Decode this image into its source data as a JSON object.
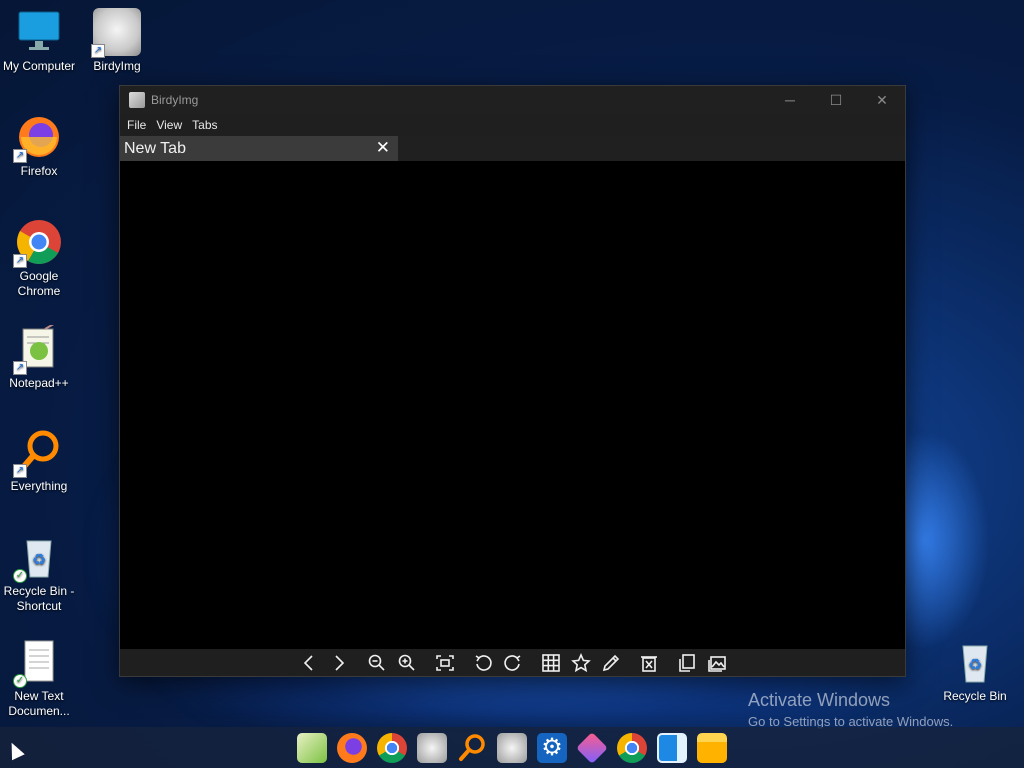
{
  "desktop": {
    "icons": [
      {
        "label": "My Computer"
      },
      {
        "label": "BirdyImg"
      },
      {
        "label": "Firefox"
      },
      {
        "label": "Google Chrome"
      },
      {
        "label": "Notepad++"
      },
      {
        "label": "Everything"
      },
      {
        "label": "Recycle Bin - Shortcut"
      },
      {
        "label": "New Text Documen..."
      },
      {
        "label": "Recycle Bin"
      }
    ]
  },
  "window": {
    "title": "BirdyImg",
    "menu": [
      "File",
      "View",
      "Tabs"
    ],
    "tab": {
      "label": "New Tab",
      "close": "✕"
    },
    "controls": {
      "minimize": "─",
      "maximize": "☐",
      "close": "✕"
    },
    "toolbar": [
      "previous-icon",
      "next-icon",
      "zoom-out-icon",
      "zoom-in-icon",
      "fit-screen-icon",
      "rotate-left-icon",
      "rotate-right-icon",
      "grid-icon",
      "star-icon",
      "edit-icon",
      "delete-icon",
      "copy-icon",
      "gallery-icon"
    ]
  },
  "watermark": {
    "line1": "Activate Windows",
    "line2": "Go to Settings to activate Windows."
  },
  "taskbar": {
    "apps": [
      "notepad-icon",
      "firefox-icon",
      "chrome-icon",
      "birdyimg-icon",
      "everything-icon",
      "birdyimg-icon",
      "settings-icon",
      "app-icon",
      "chrome-icon",
      "media-icon",
      "file-explorer-icon"
    ]
  }
}
